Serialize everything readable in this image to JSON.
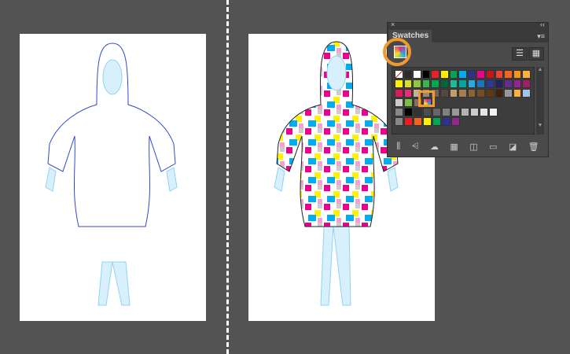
{
  "panel": {
    "title": "Swatches",
    "close": "×",
    "collapse": "‹‹",
    "menu": "▾≡",
    "list_view": "☰",
    "grid_view": "▦",
    "scroll_up": "▲",
    "scroll_down": "▼"
  },
  "swatch_rows": [
    [
      "none",
      "#2b2b2b",
      "#ffffff",
      "#000000",
      "#e8202a",
      "#fdee00",
      "#00a650",
      "#00aeef",
      "#2e3192",
      "#ec008c",
      "#c4161c",
      "#ef4136",
      "#f26522",
      "#f7941d",
      "#fbb040"
    ],
    [
      "#fff200",
      "#d7df23",
      "#8dc63f",
      "#39b54a",
      "#00a651",
      "#006838",
      "#1cbb9b",
      "#00a79d",
      "#27aae1",
      "#1c75bc",
      "#2b3990",
      "#262262",
      "#662d91",
      "#92278f",
      "#9e1f63"
    ],
    [
      "#da1c5c",
      "#ee2a7b",
      "#c7b299",
      "#998675",
      "#736357",
      "#534741",
      "#c69c6d",
      "#a67c52",
      "#8c6239",
      "#754c24",
      "#603813",
      "#42210b",
      "#999999",
      "#fbb040",
      "#9fc5e8"
    ],
    [
      "#cccccc",
      "#7ac143",
      "#8a6f5a",
      "#b03a8e"
    ],
    [
      "#888888",
      "#000000",
      "#333333",
      "#4d4d4d",
      "#666666",
      "#808080",
      "#999999",
      "#b3b3b3",
      "#cccccc",
      "#e6e6e6",
      "#f2f2f2"
    ],
    [
      "#888888",
      "#ed1c24",
      "#f26522",
      "#fff200",
      "#00a651",
      "#2e3192",
      "#92278f"
    ]
  ],
  "footer_icons": [
    "library-icon",
    "show-kinds-icon",
    "cloud-icon",
    "swatch-options-icon",
    "color-group-icon",
    "new-folder-icon",
    "new-swatch-icon",
    "delete-icon"
  ],
  "footer_glyphs": [
    "⫼",
    "⩤",
    "☁",
    "▦",
    "◫",
    "▭",
    "◪",
    "🗑"
  ],
  "accent": "#f29a2e"
}
